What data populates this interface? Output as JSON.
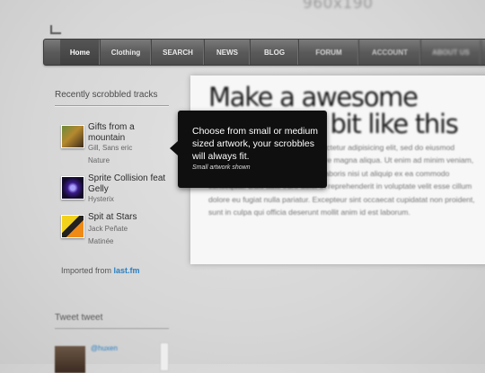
{
  "header": {
    "banner_dimensions": "960x190"
  },
  "nav": {
    "items": [
      {
        "label": "Home"
      },
      {
        "label": "Clothing"
      },
      {
        "label": "SEARCH"
      },
      {
        "label": "NEWS"
      },
      {
        "label": "BLOG"
      },
      {
        "label": "FORUM"
      },
      {
        "label": "ACCOUNT"
      },
      {
        "label": "ABOUT US"
      }
    ]
  },
  "sidebar": {
    "title": "Recently scrobbled tracks",
    "tracks": [
      {
        "name": "Gifts from a mountain",
        "artist": "Gill, Sans eric",
        "album": "Nature"
      },
      {
        "name": "Sprite Collision feat Gelly",
        "artist": "Hysterix",
        "album": ""
      },
      {
        "name": "Spit at Stars",
        "artist": "Jack Peñate",
        "album": "Matinée"
      }
    ],
    "imported_prefix": "Imported from",
    "imported_source": "last.fm",
    "tweet_title": "Tweet tweet",
    "tweet_user": "@huxen"
  },
  "main": {
    "headline": "Make a awesome website a bit like this",
    "body": "Lorem ipsum dolor sit amet, consectetur adipisicing elit, sed do eiusmod tempor incididunt ut labore et dolore magna aliqua. Ut enim ad minim veniam, quis nostrud exercitation ullamco laboris nisi ut aliquip ex ea commodo consequat. Duis aute irure dolor in reprehenderit in voluptate velit esse cillum dolore eu fugiat nulla pariatur. Excepteur sint occaecat cupidatat non proident, sunt in culpa qui officia deserunt mollit anim id est laborum."
  },
  "tooltip": {
    "text": "Choose from small or medium sized artwork, your scrobbles will always fit.",
    "subtext": "Small artwork shown"
  }
}
